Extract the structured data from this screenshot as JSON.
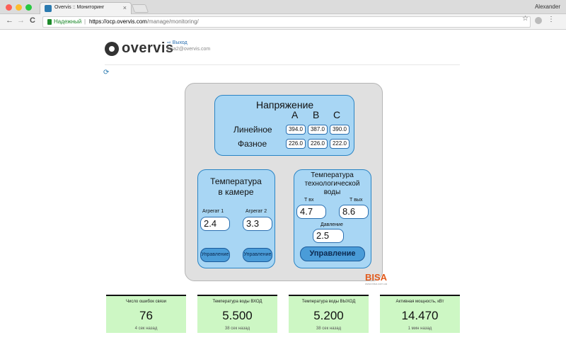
{
  "browser": {
    "tab_title": "Overvis :: Мониторинг",
    "tab_close": "×",
    "user": "Alexander",
    "secure_label": "Надежный",
    "url_host": "https://ocp.overvis.com",
    "url_path": "/manage/monitoring/",
    "nav_back": "←",
    "nav_forward": "→",
    "nav_reload": "C",
    "star": "☆",
    "menu": "⋮"
  },
  "header": {
    "logo_text": "overvis",
    "logout_label": "⇨ Выход",
    "email": "bisa2@overvis.com",
    "refresh": "⟳"
  },
  "voltage": {
    "title": "Напряжение",
    "phases": [
      "A",
      "B",
      "C"
    ],
    "line_label": "Линейное",
    "line_values": [
      "394.0",
      "387.0",
      "390.0"
    ],
    "phase_label": "Фазное",
    "phase_values": [
      "226.0",
      "226.0",
      "222.0"
    ]
  },
  "chamber": {
    "title_line1": "Температура",
    "title_line2": "в камере",
    "unit1_label": "Агрегат 1",
    "unit2_label": "Агрегат 2",
    "unit1_value": "2.4",
    "unit2_value": "3.3",
    "control1_label": "Управление",
    "control2_label": "Управление"
  },
  "water": {
    "title_line1": "Температура",
    "title_line2": "технологической",
    "title_line3": "воды",
    "tin_label": "Т вх",
    "tout_label": "Т вых",
    "tin_value": "4.7",
    "tout_value": "8.6",
    "pressure_label": "Давление",
    "pressure_value": "2.5",
    "control_label": "Управление"
  },
  "brand": {
    "text": "BISA",
    "sub": "www.bisa.com.ua"
  },
  "cards": [
    {
      "title": "Число ошибок связи",
      "value": "76",
      "time": "4 сек назад"
    },
    {
      "title": "Температура воды ВХОД",
      "value": "5.500",
      "time": "38 сек назад"
    },
    {
      "title": "Температура воды ВЫХОД",
      "value": "5.200",
      "time": "38 сек назад"
    },
    {
      "title": "Активная мощность, кВт",
      "value": "14.470",
      "time": "1 мин назад"
    }
  ],
  "colors": {
    "accent": "#2a84c4",
    "box_fill": "#a8d6f4",
    "card_fill": "#cdf7c4",
    "brand": "#e25a1c"
  }
}
